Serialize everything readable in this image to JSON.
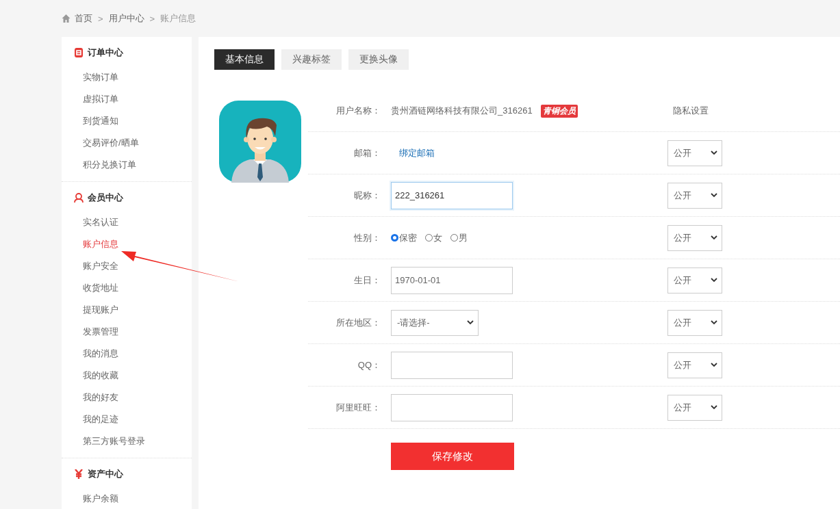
{
  "breadcrumb": [
    {
      "kind": "home",
      "label": "首页"
    },
    {
      "kind": "separator",
      "label": ">"
    },
    {
      "kind": "link",
      "label": "用户中心"
    },
    {
      "kind": "separator",
      "label": ">"
    },
    {
      "kind": "current",
      "label": "账户信息"
    }
  ],
  "sidebar": {
    "sections": [
      {
        "kind": "order",
        "title": "订单中心",
        "items": [
          {
            "label": "实物订单",
            "selected": false
          },
          {
            "label": "虚拟订单",
            "selected": false
          },
          {
            "label": "到货通知",
            "selected": false
          },
          {
            "label": "交易评价/晒单",
            "selected": false
          },
          {
            "label": "积分兑换订单",
            "selected": false
          }
        ]
      },
      {
        "kind": "person",
        "title": "会员中心",
        "items": [
          {
            "label": "实名认证",
            "selected": false
          },
          {
            "label": "账户信息",
            "selected": true
          },
          {
            "label": "账户安全",
            "selected": false
          },
          {
            "label": "收货地址",
            "selected": false
          },
          {
            "label": "提现账户",
            "selected": false
          },
          {
            "label": "发票管理",
            "selected": false
          },
          {
            "label": "我的消息",
            "selected": false
          },
          {
            "label": "我的收藏",
            "selected": false
          },
          {
            "label": "我的好友",
            "selected": false
          },
          {
            "label": "我的足迹",
            "selected": false
          },
          {
            "label": "第三方账号登录",
            "selected": false
          }
        ]
      },
      {
        "kind": "yen",
        "title": "资产中心",
        "items": [
          {
            "label": "账户余额",
            "selected": false
          }
        ]
      }
    ]
  },
  "tabs": [
    {
      "label": "基本信息",
      "selected": true
    },
    {
      "label": "兴趣标签",
      "selected": false
    },
    {
      "label": "更换头像",
      "selected": false
    }
  ],
  "profile": {
    "username": {
      "label": "用户名称：",
      "value": "贵州酒链网络科技有限公司_316261",
      "badge": "青铜会员"
    },
    "privacy_header": "隐私设置",
    "rows": [
      {
        "kind": "link",
        "label": "邮箱：",
        "value": "绑定邮箱",
        "privacy": "公开"
      },
      {
        "kind": "text",
        "label": "昵称：",
        "value": "222_316261",
        "focused": true,
        "privacy": "公开"
      },
      {
        "kind": "radio",
        "label": "性别：",
        "options": [
          {
            "label": "保密",
            "selected": true
          },
          {
            "label": "女",
            "selected": false
          },
          {
            "label": "男",
            "selected": false
          }
        ],
        "privacy": "公开"
      },
      {
        "kind": "text",
        "label": "生日：",
        "value": "1970-01-01",
        "focused": false,
        "privacy": "公开"
      },
      {
        "kind": "select",
        "label": "所在地区：",
        "value": "-请选择-",
        "privacy": "公开"
      },
      {
        "kind": "text",
        "label": "QQ：",
        "focused": false,
        "privacy": "公开"
      },
      {
        "kind": "text",
        "label": "阿里旺旺：",
        "focused": false,
        "privacy": "公开"
      }
    ],
    "save_button": "保存修改"
  }
}
